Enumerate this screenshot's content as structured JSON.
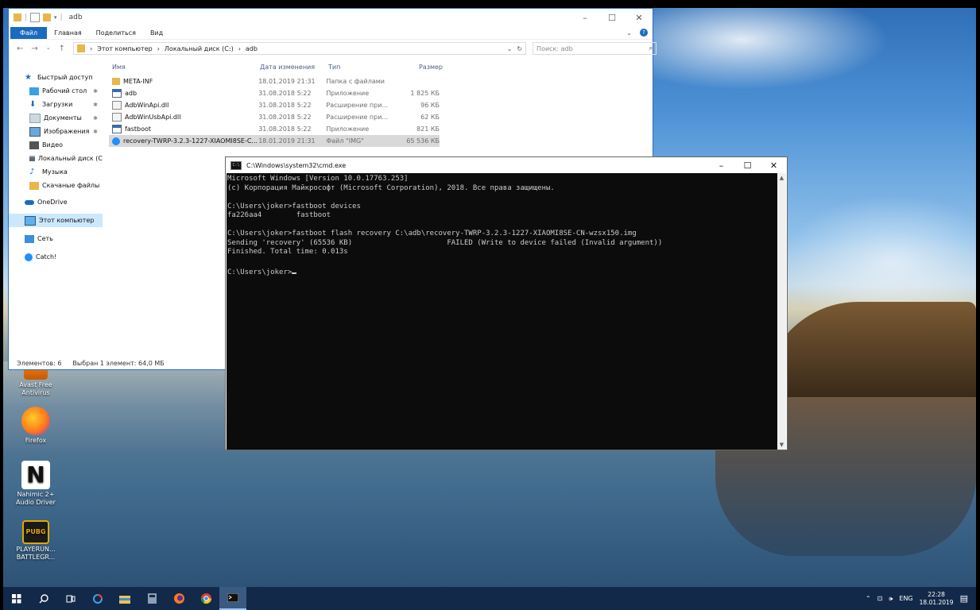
{
  "explorer": {
    "title": "adb",
    "ribbon_tabs": [
      "Файл",
      "Главная",
      "Поделиться",
      "Вид"
    ],
    "breadcrumbs": [
      "Этот компьютер",
      "Локальный диск (C:)",
      "adb"
    ],
    "search_placeholder": "Поиск: adb",
    "columns": {
      "name": "Имя",
      "date": "Дата изменения",
      "type": "Тип",
      "size": "Размер"
    },
    "sidebar": [
      {
        "label": "Быстрый доступ",
        "icon": "star-icon",
        "pinned": false
      },
      {
        "label": "Рабочий стол",
        "icon": "desktop-folder-icon",
        "pinned": true
      },
      {
        "label": "Загрузки",
        "icon": "download-icon",
        "pinned": true
      },
      {
        "label": "Документы",
        "icon": "documents-icon",
        "pinned": true
      },
      {
        "label": "Изображения",
        "icon": "pictures-icon",
        "pinned": true
      },
      {
        "label": "Видео",
        "icon": "video-icon",
        "pinned": false
      },
      {
        "label": "Локальный диск (C",
        "icon": "drive-icon",
        "pinned": false
      },
      {
        "label": "Музыка",
        "icon": "music-icon",
        "pinned": false
      },
      {
        "label": "Скачаные файлы",
        "icon": "folder-icon",
        "pinned": false
      },
      {
        "label": "OneDrive",
        "icon": "cloud-icon",
        "pinned": false
      },
      {
        "label": "Этот компьютер",
        "icon": "computer-icon",
        "pinned": false
      },
      {
        "label": "Сеть",
        "icon": "network-icon",
        "pinned": false
      },
      {
        "label": "Catch!",
        "icon": "catch-icon",
        "pinned": false
      }
    ],
    "files": [
      {
        "name": "META-INF",
        "date": "18.01.2019 21:31",
        "type": "Папка с файлами",
        "size": "",
        "icon": "folder-icon"
      },
      {
        "name": "adb",
        "date": "31.08.2018 5:22",
        "type": "Приложение",
        "size": "1 825 КБ",
        "icon": "app-icon"
      },
      {
        "name": "AdbWinApi.dll",
        "date": "31.08.2018 5:22",
        "type": "Расширение при...",
        "size": "96 КБ",
        "icon": "dll-icon"
      },
      {
        "name": "AdbWinUsbApi.dll",
        "date": "31.08.2018 5:22",
        "type": "Расширение при...",
        "size": "62 КБ",
        "icon": "dll-icon"
      },
      {
        "name": "fastboot",
        "date": "31.08.2018 5:22",
        "type": "Приложение",
        "size": "821 КБ",
        "icon": "app-icon"
      },
      {
        "name": "recovery-TWRP-3.2.3-1227-XIAOMI8SE-C...",
        "date": "18.01.2019 21:31",
        "type": "Файл \"IMG\"",
        "size": "65 536 КБ",
        "icon": "img-file-icon"
      }
    ],
    "status_count": "Элементов: 6",
    "status_selected": "Выбран 1 элемент: 64,0 МБ"
  },
  "cmd": {
    "title": "C:\\Windows\\system32\\cmd.exe",
    "lines": [
      "Microsoft Windows [Version 10.0.17763.253]",
      "(c) Корпорация Майкрософт (Microsoft Corporation), 2018. Все права защищены.",
      "",
      "C:\\Users\\joker>fastboot devices",
      "fa226aa4        fastboot",
      "",
      "C:\\Users\\joker>fastboot flash recovery C:\\adb\\recovery-TWRP-3.2.3-1227-XIAOMI8SE-CN-wzsx150.img",
      "Sending 'recovery' (65536 KB)                      FAILED (Write to device failed (Invalid argument))",
      "Finished. Total time: 0.013s",
      "",
      "C:\\Users\\joker>"
    ]
  },
  "desktop_icons": [
    {
      "label": "Avast Free Antivirus",
      "icon": "avast-icon"
    },
    {
      "label": "Firefox",
      "icon": "firefox-icon"
    },
    {
      "label": "Nahimic 2+ Audio Driver",
      "icon": "nahimic-icon"
    },
    {
      "label": "PLAYERUN... BATTLEGR...",
      "icon": "pubg-icon"
    }
  ],
  "taskbar": {
    "items": [
      "start-icon",
      "search-icon",
      "task-view-icon",
      "chrome-like-icon",
      "file-explorer-icon",
      "calculator-icon",
      "firefox-icon",
      "chrome-icon",
      "cmd-icon"
    ],
    "language": "ENG",
    "time": "22:28",
    "date": "18.01.2019"
  },
  "colors": {
    "accent": "#1b6ac0",
    "console_bg": "#0c0c0c",
    "console_fg": "#cccccc",
    "taskbar": "#13294a"
  }
}
